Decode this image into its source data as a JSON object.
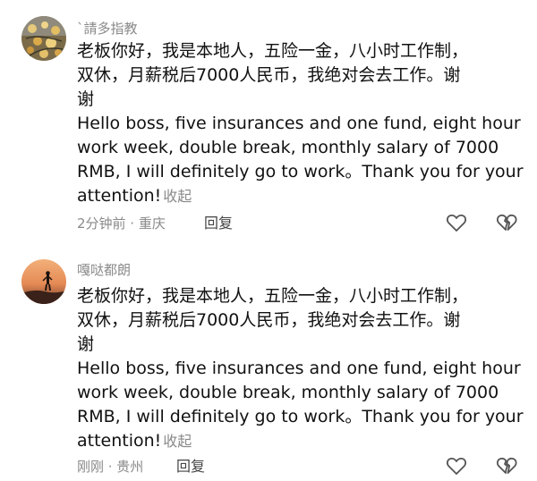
{
  "comments": [
    {
      "username": "`請多指教",
      "text_zh": [
        "老板你好，我是本地人，五险一金，八小时工作制，",
        "双休，月薪税后7000人民币，我绝对会去工作。谢",
        "谢"
      ],
      "text_en": [
        "Hello boss, five insurances and one fund, eight hour",
        "work week, double break, monthly salary of 7000",
        "RMB, I will definitely go to work。Thank you for your",
        "attention!"
      ],
      "collapse_label": "收起",
      "time_location": "2分钟前 · 重庆",
      "reply_label": "回复",
      "like_icon": "heart-icon",
      "dislike_icon": "broken-heart-icon"
    },
    {
      "username": "嘎哒都朗",
      "text_zh": [
        "老板你好，我是本地人，五险一金，八小时工作制，",
        "双休，月薪税后7000人民币，我绝对会去工作。谢",
        "谢"
      ],
      "text_en": [
        "Hello boss, five insurances and one fund, eight hour",
        "work week, double break, monthly salary of 7000",
        "RMB, I will definitely go to work。Thank you for your",
        "attention!"
      ],
      "collapse_label": "收起",
      "time_location": "刚刚 · 贵州",
      "reply_label": "回复",
      "like_icon": "heart-icon",
      "dislike_icon": "broken-heart-icon"
    }
  ]
}
